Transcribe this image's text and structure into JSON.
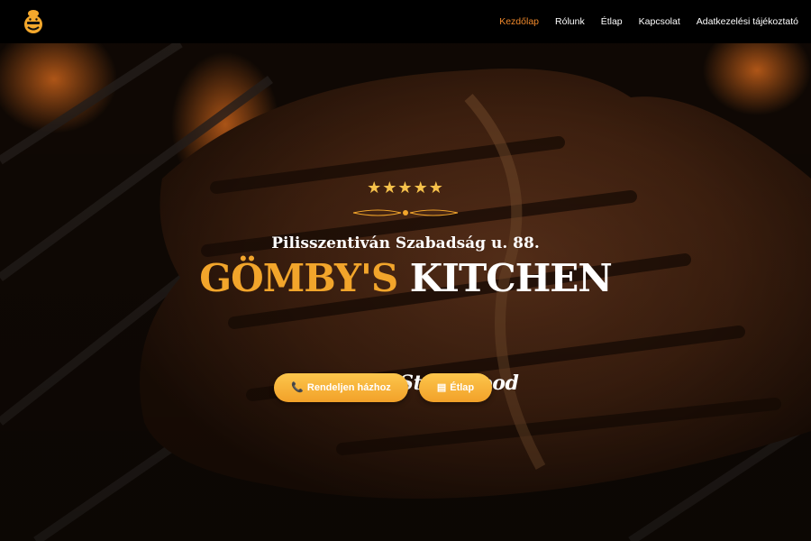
{
  "nav": {
    "logo_icon": "chef-burger-logo",
    "items": [
      {
        "label": "Kezdőlap",
        "active": true
      },
      {
        "label": "Rólunk",
        "active": false
      },
      {
        "label": "Étlap",
        "active": false
      },
      {
        "label": "Kapcsolat",
        "active": false
      },
      {
        "label": "Adatkezelési tájékoztató",
        "active": false
      }
    ]
  },
  "hero": {
    "background_icon": "grilled-steak-photo",
    "stars": "★★★★★",
    "rating": 5,
    "address": "Pilisszentiván Szabadság u. 88.",
    "title_name": "GÖMBY'S",
    "title_rest": "KITCHEN",
    "tagline": "A legjobb Street food",
    "buttons": {
      "order": {
        "icon": "phone-icon",
        "glyph": "📞",
        "label": "Rendeljen házhoz"
      },
      "menu": {
        "icon": "menu-book-icon",
        "glyph": "▤",
        "label": "Étlap"
      }
    }
  },
  "colors": {
    "accent": "#f0892b",
    "brand_gold": "#f2a52b",
    "button": "#f9b53c",
    "navbar": "#000000"
  }
}
